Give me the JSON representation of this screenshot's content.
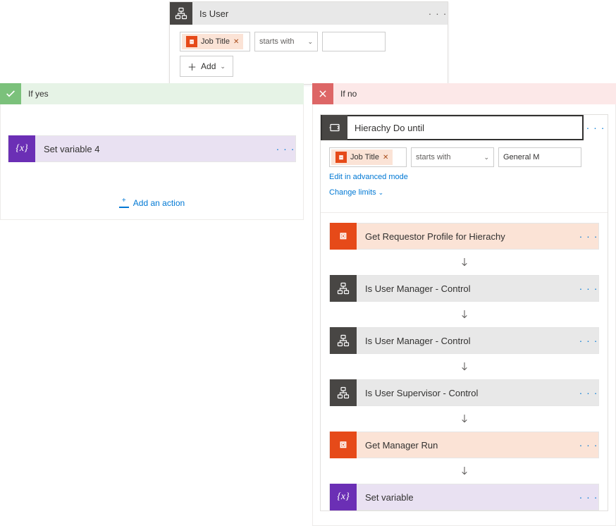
{
  "top_condition": {
    "title": "Is User",
    "token_label": "Job Title",
    "operator": "starts with",
    "value": "",
    "add_label": "Add"
  },
  "branches": {
    "yes": {
      "label": "If yes",
      "action1": "Set variable 4",
      "add_action": "Add an action"
    },
    "no": {
      "label": "If no",
      "do_until": {
        "title": "Hierachy Do until",
        "token_label": "Job Title",
        "operator": "starts with",
        "value": "General M",
        "edit_mode_link": "Edit in advanced mode",
        "change_limits_link": "Change limits"
      },
      "steps": [
        {
          "type": "orange",
          "label": "Get Requestor Profile for Hierachy"
        },
        {
          "type": "gray",
          "label": "Is User        Manager - Control"
        },
        {
          "type": "gray",
          "label": "Is User Manager - Control"
        },
        {
          "type": "gray",
          "label": "Is User Supervisor - Control"
        },
        {
          "type": "orange",
          "label": "Get Manager      Run"
        },
        {
          "type": "purple",
          "label": "Set variable"
        }
      ]
    }
  }
}
